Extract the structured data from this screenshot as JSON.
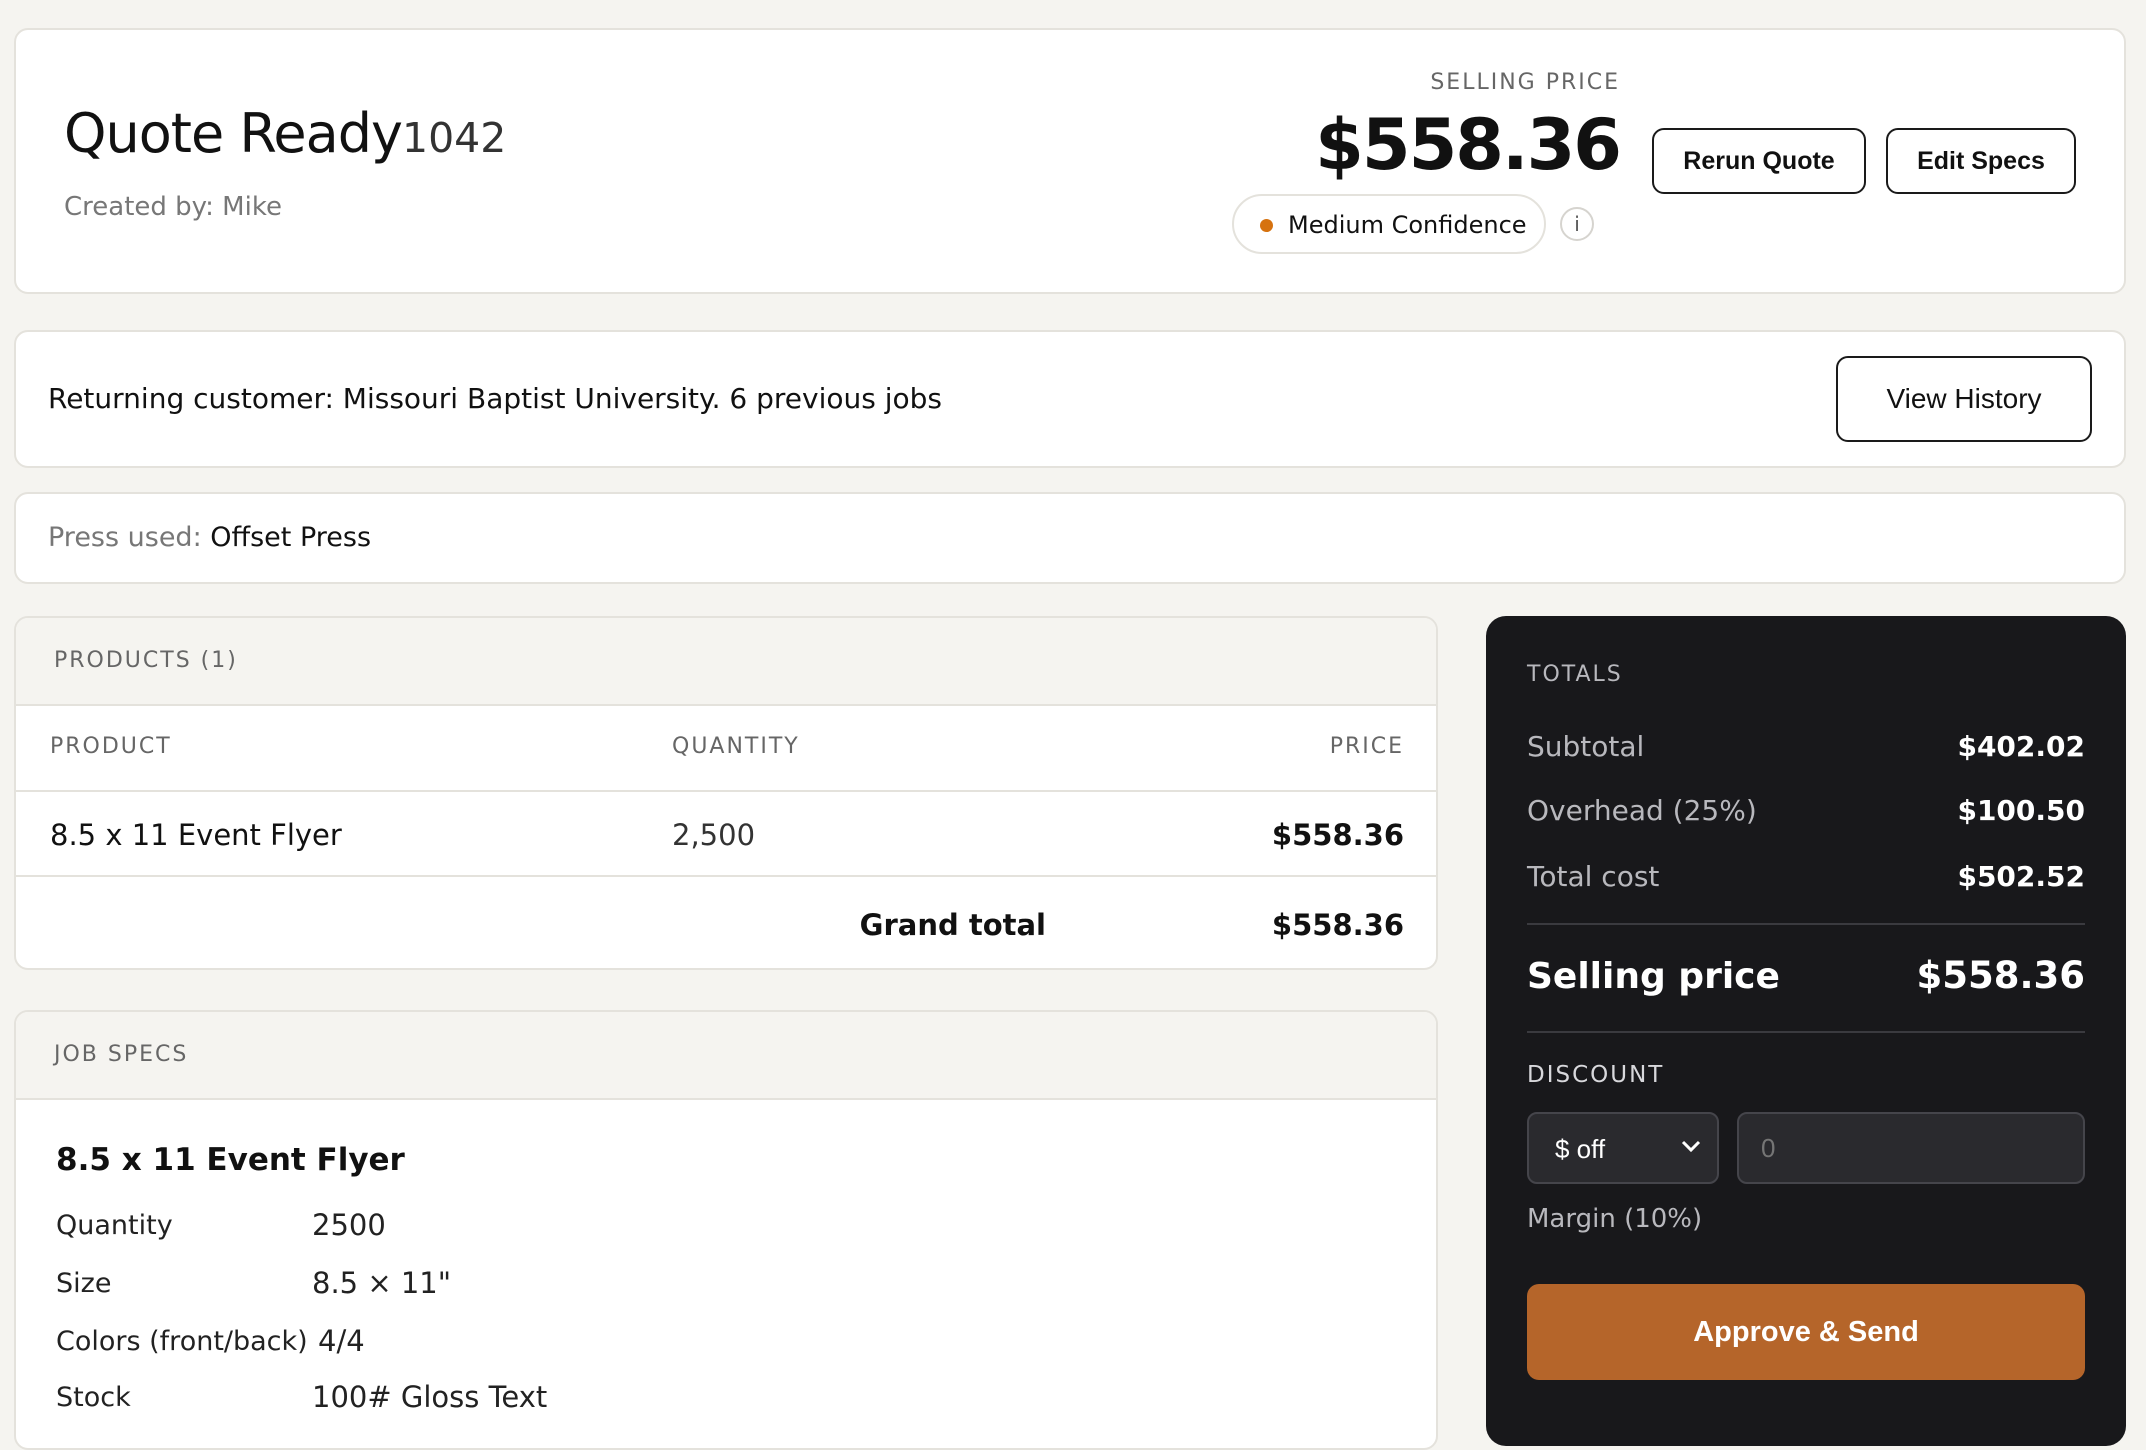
{
  "header": {
    "title": "Quote Ready",
    "job_number": "1042",
    "created_by": "Created by: Mike",
    "selling_price_label": "SELLING PRICE",
    "selling_price": "$558.36",
    "confidence": "Medium Confidence",
    "confidence_color": "#d6720f",
    "info_glyph": "i",
    "rerun_label": "Rerun Quote",
    "edit_label": "Edit Specs"
  },
  "customer": {
    "text": "Returning customer: Missouri Baptist University. 6 previous jobs",
    "history_label": "View History"
  },
  "press": {
    "label": "Press used:",
    "value": "Offset Press"
  },
  "products": {
    "title": "PRODUCTS (1)",
    "columns": [
      "PRODUCT",
      "QUANTITY",
      "PRICE"
    ],
    "rows": [
      {
        "product": "8.5 x 11 Event Flyer",
        "quantity": "2,500",
        "price": "$558.36"
      }
    ],
    "grand_total_label": "Grand total",
    "grand_total": "$558.36"
  },
  "job_specs": {
    "title": "JOB SPECS",
    "product_name": "8.5 x 11 Event Flyer",
    "items": [
      {
        "key": "Quantity",
        "value": "2500"
      },
      {
        "key": "Size",
        "value": "8.5 × 11\""
      },
      {
        "key": "Colors (front/back)",
        "value": "4/4"
      },
      {
        "key": "Stock",
        "value": "100# Gloss Text"
      }
    ]
  },
  "totals": {
    "title": "TOTALS",
    "lines": [
      {
        "label": "Subtotal",
        "value": "$402.02"
      },
      {
        "label": "Overhead (25%)",
        "value": "$100.50"
      },
      {
        "label": "Total cost",
        "value": "$502.52"
      }
    ],
    "selling_label": "Selling price",
    "selling_value": "$558.36",
    "discount_label": "DISCOUNT",
    "discount_type": "$ off",
    "discount_placeholder": "0",
    "margin": "Margin (10%)",
    "approve_label": "Approve & Send",
    "accent": "#b5652a"
  }
}
